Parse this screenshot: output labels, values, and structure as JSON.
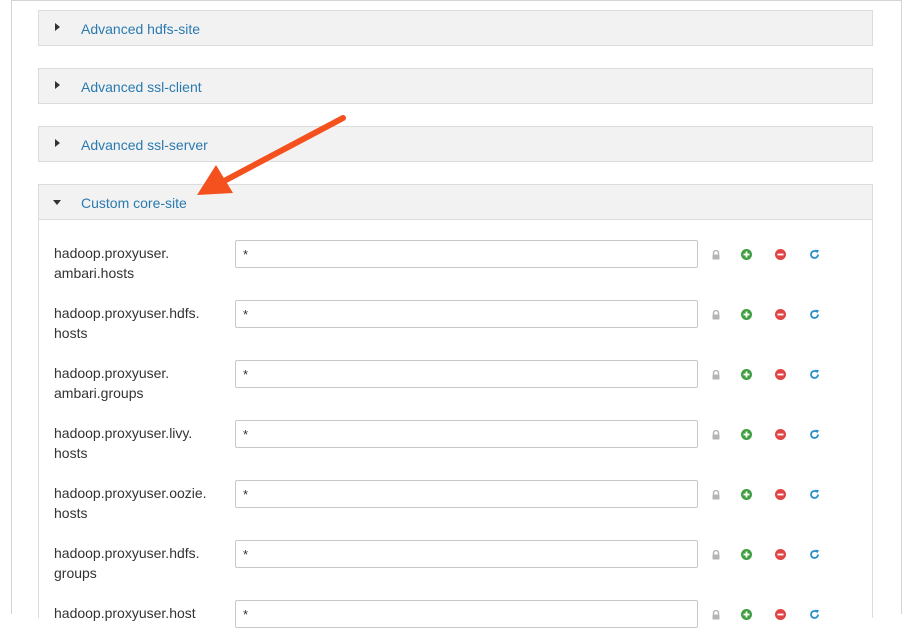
{
  "panels": [
    {
      "title": "Advanced hdfs-site",
      "expanded": false
    },
    {
      "title": "Advanced ssl-client",
      "expanded": false
    },
    {
      "title": "Advanced ssl-server",
      "expanded": false
    },
    {
      "title": "Custom core-site",
      "expanded": true
    }
  ],
  "properties": [
    {
      "label_line1": "hadoop.proxyuser.",
      "label_line2": "ambari.hosts",
      "value": "*"
    },
    {
      "label_line1": "hadoop.proxyuser.hdfs.",
      "label_line2": "hosts",
      "value": "*"
    },
    {
      "label_line1": "hadoop.proxyuser.",
      "label_line2": "ambari.groups",
      "value": "*"
    },
    {
      "label_line1": "hadoop.proxyuser.livy.",
      "label_line2": "hosts",
      "value": "*"
    },
    {
      "label_line1": "hadoop.proxyuser.oozie.",
      "label_line2": "hosts",
      "value": "*"
    },
    {
      "label_line1": "hadoop.proxyuser.hdfs.",
      "label_line2": "groups",
      "value": "*"
    },
    {
      "label_line1": "hadoop.proxyuser.host",
      "label_line2": "",
      "value": "*"
    }
  ],
  "row_icons": [
    "lock-icon",
    "add-icon",
    "remove-icon",
    "refresh-icon"
  ],
  "colors": {
    "link": "#2a7ab0",
    "panel_bg": "#f2f2f2",
    "lock": "#b5b5b5",
    "add": "#3f9f3f",
    "remove": "#e04444",
    "refresh": "#2a8fc8",
    "annotation_arrow": "#f4511e"
  }
}
